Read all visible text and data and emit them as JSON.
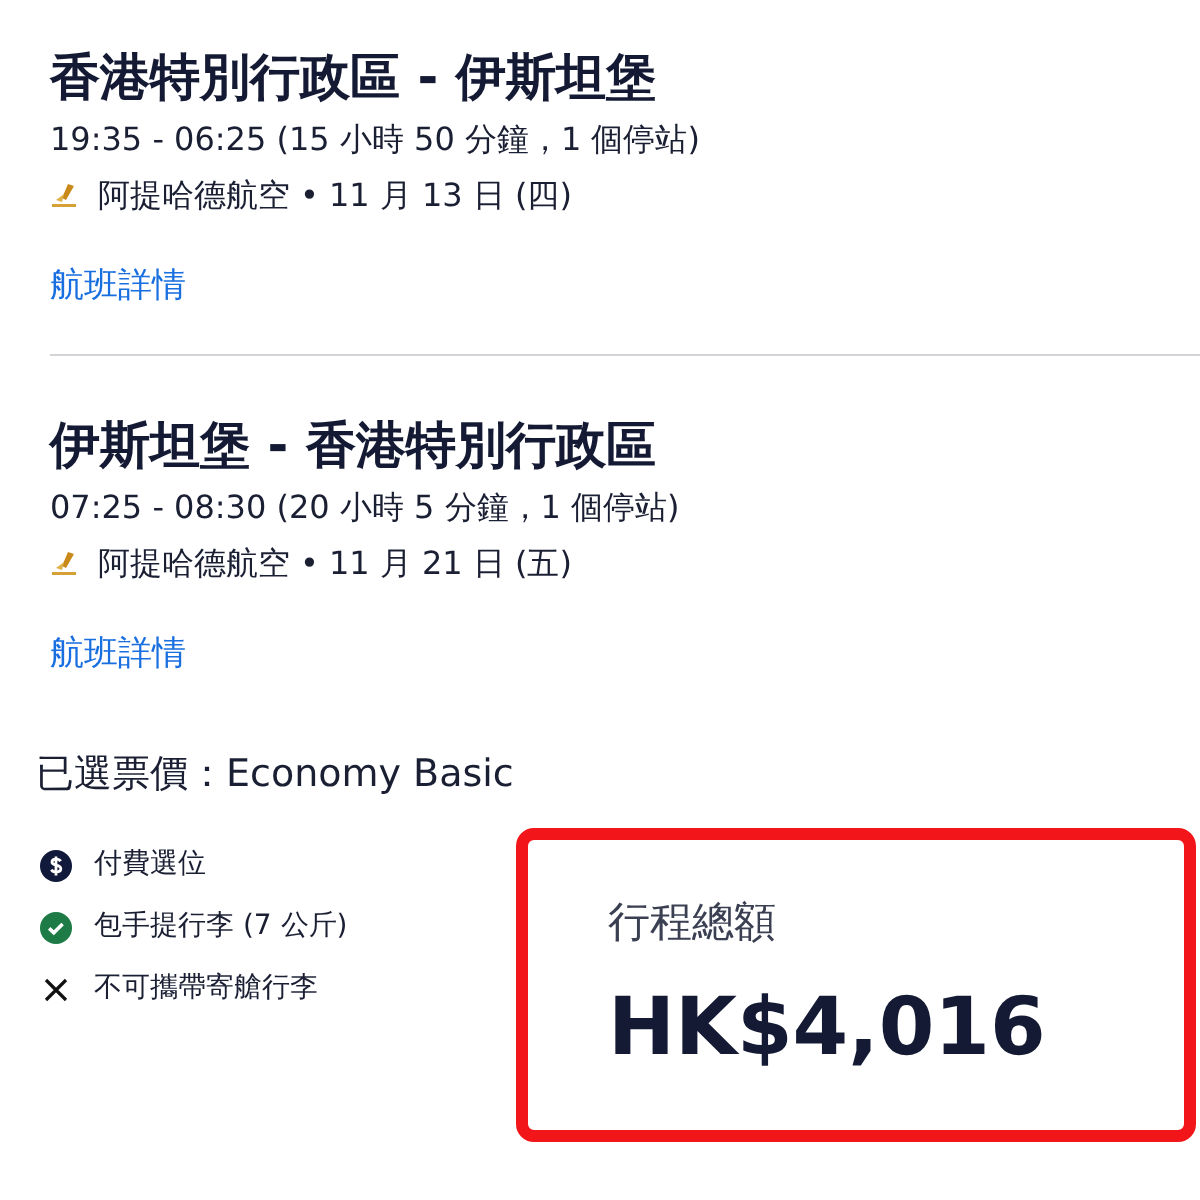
{
  "flights": [
    {
      "route": "香港特別行政區 - 伊斯坦堡",
      "times": "19:35 - 06:25 (15 小時 50 分鐘，1 個停站)",
      "airline": "阿提哈德航空",
      "separator": "•",
      "date": "11 月 13 日 (四)",
      "link": "航班詳情"
    },
    {
      "route": "伊斯坦堡 - 香港特別行政區",
      "times": "07:25 - 08:30 (20 小時 5 分鐘，1 個停站)",
      "airline": "阿提哈德航空",
      "separator": "•",
      "date": "11 月 21 日 (五)",
      "link": "航班詳情"
    }
  ],
  "fare": {
    "label": "已選票價：Economy Basic"
  },
  "features": [
    {
      "kind": "paid",
      "text": "付費選位"
    },
    {
      "kind": "included",
      "text": "包手提行李 (7 公斤)"
    },
    {
      "kind": "excluded",
      "text": "不可攜帶寄艙行李"
    }
  ],
  "total": {
    "label": "行程總額",
    "amount": "HK$4,016"
  }
}
